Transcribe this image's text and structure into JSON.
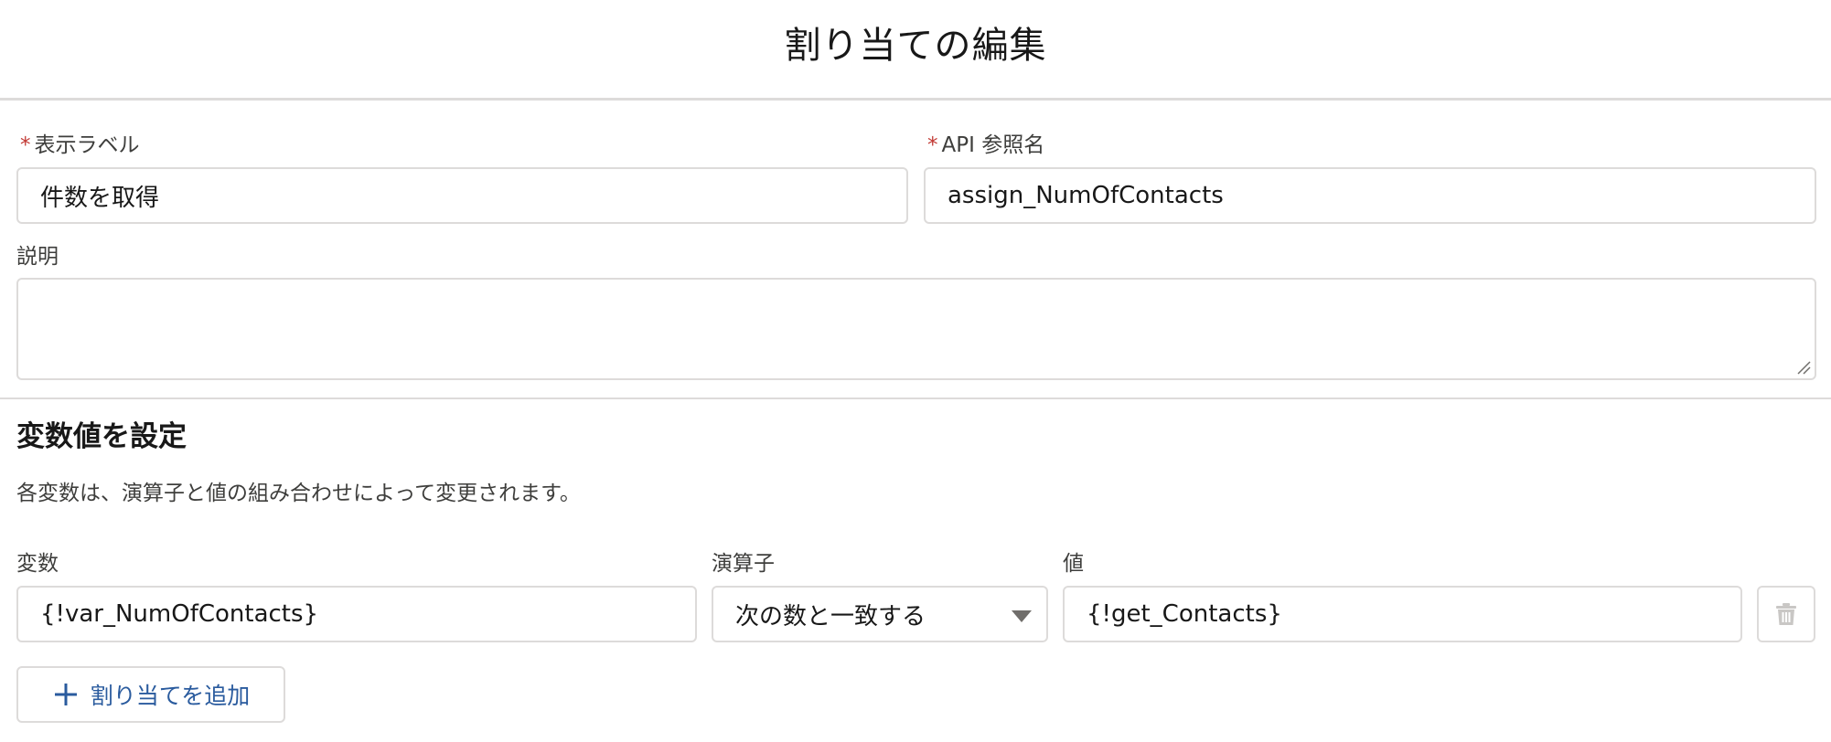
{
  "header": {
    "title": "割り当ての編集"
  },
  "form": {
    "label": {
      "text": "表示ラベル",
      "required": "*",
      "value": "件数を取得"
    },
    "api_name": {
      "text": "API 参照名",
      "required": "*",
      "value": "assign_NumOfContacts"
    },
    "description": {
      "text": "説明",
      "value": ""
    }
  },
  "assignments": {
    "section_title": "変数値を設定",
    "section_desc": "各変数は、演算子と値の組み合わせによって変更されます。",
    "columns": {
      "variable": "変数",
      "operator": "演算子",
      "value": "値"
    },
    "rows": [
      {
        "variable": "{!var_NumOfContacts}",
        "operator": "次の数と一致する",
        "value": "{!get_Contacts}"
      }
    ],
    "add_button_label": "割り当てを追加"
  },
  "icons": {
    "delete": "trash-icon",
    "add": "plus-icon",
    "dropdown": "chevron-down-icon",
    "resize": "resize-grip-icon"
  },
  "colors": {
    "required": "#c23934",
    "accent": "#0176d3",
    "border": "#dddbda"
  }
}
